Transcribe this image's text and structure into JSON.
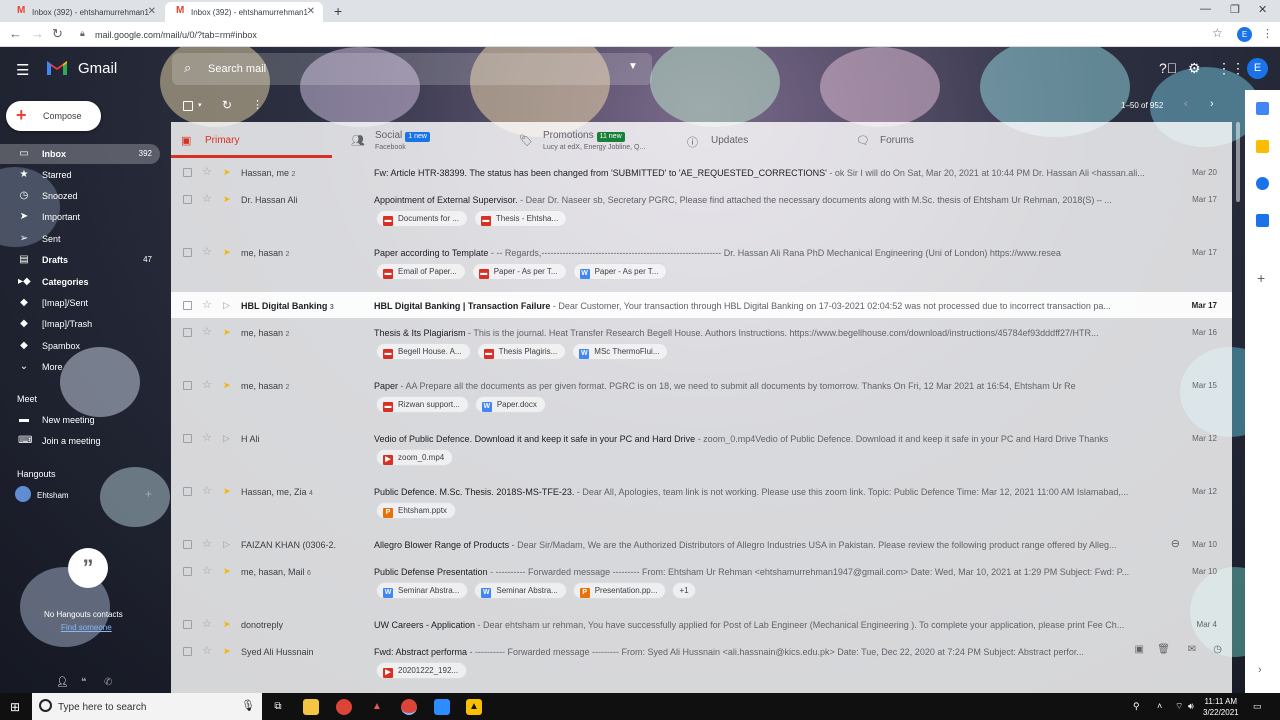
{
  "browser": {
    "tabs": [
      {
        "title": "Inbox (392) - ehtshamurrehman1"
      },
      {
        "title": "Inbox (392) - ehtshamurrehman1"
      }
    ],
    "url": "mail.google.com/mail/u/0/?tab=rm#inbox",
    "profile_initial": "E"
  },
  "gmail": {
    "app_name": "Gmail",
    "search_placeholder": "Search mail",
    "account_initial": "E",
    "compose_label": "Compose",
    "pager": "1–50 of 952"
  },
  "sidebar": {
    "items": [
      {
        "label": "Inbox",
        "count": "392",
        "icon": "inbox-icon"
      },
      {
        "label": "Starred",
        "count": "",
        "icon": "star-icon"
      },
      {
        "label": "Snoozed",
        "count": "",
        "icon": "clock-icon"
      },
      {
        "label": "Important",
        "count": "",
        "icon": "important-icon"
      },
      {
        "label": "Sent",
        "count": "",
        "icon": "send-icon"
      },
      {
        "label": "Drafts",
        "count": "47",
        "icon": "draft-icon"
      },
      {
        "label": "Categories",
        "count": "",
        "icon": "label-icon"
      },
      {
        "label": "[Imap]/Sent",
        "count": "",
        "icon": "label-icon"
      },
      {
        "label": "[Imap]/Trash",
        "count": "",
        "icon": "label-icon"
      },
      {
        "label": "Spambox",
        "count": "",
        "icon": "label-icon"
      },
      {
        "label": "More",
        "count": "",
        "icon": "chevron-down-icon"
      }
    ],
    "meet_title": "Meet",
    "meet_items": [
      {
        "label": "New meeting"
      },
      {
        "label": "Join a meeting"
      }
    ],
    "hangouts_title": "Hangouts",
    "hangouts_user": "Ehtsham",
    "no_contacts": "No Hangouts contacts",
    "find_someone": "Find someone"
  },
  "category_tabs": [
    {
      "label": "Primary",
      "badge": "",
      "sub": ""
    },
    {
      "label": "Social",
      "badge": "1 new",
      "sub": "Facebook",
      "badge_color": "#1a73e8"
    },
    {
      "label": "Promotions",
      "badge": "11 new",
      "sub": "Lucy at edX, Energy Jobline, Q...",
      "badge_color": "#188038"
    },
    {
      "label": "Updates",
      "badge": "",
      "sub": ""
    },
    {
      "label": "Forums",
      "badge": "",
      "sub": ""
    }
  ],
  "emails": [
    {
      "sender": "Hassan, me",
      "count": "2",
      "subject": "Fw: Article HTR-38399. The status has been changed from 'SUBMITTED' to 'AE_REQUESTED_CORRECTIONS'",
      "snippet": " - ok Sir I will do On Sat, Mar 20, 2021 at 10:44 PM Dr. Hassan Ali <hassan.ali...",
      "date": "Mar 20",
      "important": true,
      "unread": false,
      "attachments": []
    },
    {
      "sender": "Dr. Hassan Ali",
      "count": "",
      "subject": "Appointment of External Supervisor.",
      "snippet": " - Dear Dr. Naseer sb, Secretary PGRC, Please find attached the necessary documents along with M.Sc. thesis of Ehtsham Ur Rehman, 2018(S) – ...",
      "date": "Mar 17",
      "important": true,
      "unread": false,
      "attachments": [
        {
          "name": "Documents for ...",
          "type": "pdf"
        },
        {
          "name": "Thesis - Ehtsha...",
          "type": "pdf"
        }
      ]
    },
    {
      "sender": "me, hasan",
      "count": "2",
      "subject": "Paper according to Template",
      "snippet": " - -- Regards,------------------------------------------------------------ Dr. Hassan Ali Rana PhD Mechanical Engineering (Uni of London) https://www.resea",
      "date": "Mar 17",
      "important": true,
      "unread": false,
      "attachments": [
        {
          "name": "Email of Paper...",
          "type": "pdf"
        },
        {
          "name": "Paper - As per T...",
          "type": "pdf"
        },
        {
          "name": "Paper - As per T...",
          "type": "word"
        }
      ]
    },
    {
      "sender": "HBL Digital Banking",
      "count": "3",
      "subject": "HBL Digital Banking | Transaction Failure",
      "snippet": " - Dear Customer, Your transaction through HBL Digital Banking on 17-03-2021 02:04:52 was not processed due to incorrect transaction pa...",
      "date": "Mar 17",
      "important": false,
      "unread": true,
      "attachments": []
    },
    {
      "sender": "me, hasan",
      "count": "2",
      "subject": "Thesis & Its Plagiarism",
      "snippet": " - This is the journal. Heat Transfer Research Begell House. Authors Instructions. https://www.begellhouse.com/download/instructions/45784ef93dddff27/HTR...",
      "date": "Mar 16",
      "important": true,
      "unread": false,
      "attachments": [
        {
          "name": "Begell House. A...",
          "type": "pdf"
        },
        {
          "name": "Thesis Plagiris...",
          "type": "pdf"
        },
        {
          "name": "MSc ThermoFlui...",
          "type": "word"
        }
      ]
    },
    {
      "sender": "me, hasan",
      "count": "2",
      "subject": "Paper",
      "snippet": " - AA Prepare all the documents as per given format. PGRC is on 18, we need to submit all documents by tomorrow. Thanks On Fri, 12 Mar 2021 at 16:54, Ehtsham Ur Re",
      "date": "Mar 15",
      "important": true,
      "unread": false,
      "attachments": [
        {
          "name": "Rizwan support...",
          "type": "pdf"
        },
        {
          "name": "Paper.docx",
          "type": "word"
        }
      ]
    },
    {
      "sender": "H Ali",
      "count": "",
      "subject": "Vedio of Public Defence. Download it and keep it safe in your PC and Hard Drive",
      "snippet": " - zoom_0.mp4Vedio of Public Defence. Download it and keep it safe in your PC and Hard Drive Thanks",
      "date": "Mar 12",
      "important": false,
      "unread": false,
      "attachments": [
        {
          "name": "zoom_0.mp4",
          "type": "video"
        }
      ]
    },
    {
      "sender": "Hassan, me, Zia",
      "count": "4",
      "subject": "Public Defence. M.Sc. Thesis. 2018S-MS-TFE-23.",
      "snippet": " - Dear All, Apologies, team link is not working. Please use this zoom link. Topic: Public Defence Time: Mar 12, 2021 11:00 AM Islamabad,...",
      "date": "Mar 12",
      "important": true,
      "unread": false,
      "attachments": [
        {
          "name": "Ehtsham.pptx",
          "type": "ppt"
        }
      ]
    },
    {
      "sender": "FAIZAN KHAN (0306-2.",
      "count": "",
      "subject": "Allegro Blower Range of Products",
      "snippet": " - Dear Sir/Madam, We are the Authorized Distributors of Allegro Industries USA in Pakistan. Please review the following product range offered by Alleg...",
      "date": "Mar 10",
      "important": false,
      "unread": false,
      "attachments": []
    },
    {
      "sender": "me, hasan, Mail",
      "count": "6",
      "subject": "Public Defense Presentation",
      "snippet": " - ---------- Forwarded message --------- From: Ehtsham Ur Rehman <ehtshamurrehman1947@gmail.com> Date: Wed, Mar 10, 2021 at 1:29 PM Subject: Fwd: P...",
      "date": "Mar 10",
      "important": true,
      "unread": false,
      "attachments": [
        {
          "name": "Seminar Abstra...",
          "type": "word"
        },
        {
          "name": "Seminar Abstra...",
          "type": "word"
        },
        {
          "name": "Presentation.pp...",
          "type": "ppt"
        }
      ],
      "more": "+1"
    },
    {
      "sender": "donotreply",
      "count": "",
      "subject": "UW Careers - Application",
      "snippet": " - Dear ehtsham ur rehman, You have successfully applied for Post of Lab Engineer (Mechanical Engineering ). To complete your application, please print Fee Ch...",
      "date": "Mar 4",
      "important": true,
      "unread": false,
      "attachments": []
    },
    {
      "sender": "Syed Ali Hussnain",
      "count": "",
      "subject": "Fwd: Abstract performa",
      "snippet": " - ---------- Forwarded message --------- From: Syed Ali Hussnain <ali.hassnain@kics.edu.pk> Date: Tue, Dec 22, 2020 at 7:24 PM Subject: Abstract perfor...",
      "date": "",
      "important": true,
      "unread": false,
      "attachments": [
        {
          "name": "20201222_192...",
          "type": "video"
        }
      ]
    }
  ],
  "taskbar": {
    "search_placeholder": "Type here to search",
    "time": "11:11 AM",
    "date": "3/22/2021"
  },
  "colors": {
    "accent": "#d93025",
    "brand_blue": "#1a73e8",
    "important": "#f4b400"
  }
}
